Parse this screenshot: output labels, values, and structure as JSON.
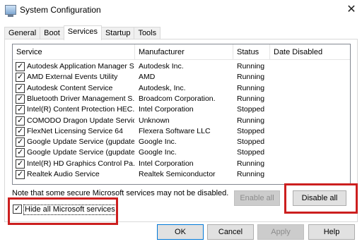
{
  "window": {
    "title": "System Configuration",
    "close_glyph": "✕"
  },
  "tabs": [
    {
      "label": "General"
    },
    {
      "label": "Boot"
    },
    {
      "label": "Services",
      "active": true
    },
    {
      "label": "Startup"
    },
    {
      "label": "Tools"
    }
  ],
  "services_list": {
    "columns": [
      "Service",
      "Manufacturer",
      "Status",
      "Date Disabled"
    ],
    "rows": [
      {
        "checked": true,
        "service": "Autodesk Application Manager S...",
        "manufacturer": "Autodesk Inc.",
        "status": "Running",
        "date_disabled": ""
      },
      {
        "checked": true,
        "service": "AMD External Events Utility",
        "manufacturer": "AMD",
        "status": "Running",
        "date_disabled": ""
      },
      {
        "checked": true,
        "service": "Autodesk Content Service",
        "manufacturer": "Autodesk, Inc.",
        "status": "Running",
        "date_disabled": ""
      },
      {
        "checked": true,
        "service": "Bluetooth Driver Management S...",
        "manufacturer": "Broadcom Corporation.",
        "status": "Running",
        "date_disabled": ""
      },
      {
        "checked": true,
        "service": "Intel(R) Content Protection HEC...",
        "manufacturer": "Intel Corporation",
        "status": "Stopped",
        "date_disabled": ""
      },
      {
        "checked": true,
        "service": "COMODO Dragon Update Service",
        "manufacturer": "Unknown",
        "status": "Running",
        "date_disabled": ""
      },
      {
        "checked": true,
        "service": "FlexNet Licensing Service 64",
        "manufacturer": "Flexera Software LLC",
        "status": "Stopped",
        "date_disabled": ""
      },
      {
        "checked": true,
        "service": "Google Update Service (gupdate)",
        "manufacturer": "Google Inc.",
        "status": "Stopped",
        "date_disabled": ""
      },
      {
        "checked": true,
        "service": "Google Update Service (gupdatem)",
        "manufacturer": "Google Inc.",
        "status": "Stopped",
        "date_disabled": ""
      },
      {
        "checked": true,
        "service": "Intel(R) HD Graphics Control Pa...",
        "manufacturer": "Intel Corporation",
        "status": "Running",
        "date_disabled": ""
      },
      {
        "checked": true,
        "service": "Realtek Audio Service",
        "manufacturer": "Realtek Semiconductor",
        "status": "Running",
        "date_disabled": ""
      }
    ]
  },
  "note": "Note that some secure Microsoft services may not be disabled.",
  "buttons": {
    "enable_all": "Enable all",
    "disable_all": "Disable all",
    "ok": "OK",
    "cancel": "Cancel",
    "apply": "Apply",
    "help": "Help"
  },
  "hide_microsoft": {
    "label": "Hide all Microsoft services",
    "checked": true
  },
  "colors": {
    "highlight": "#cc1f1f",
    "focus_border": "#0078d7"
  }
}
